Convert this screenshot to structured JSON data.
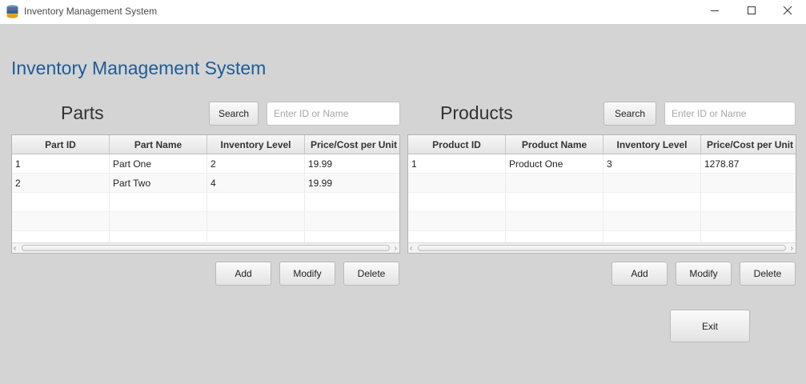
{
  "window": {
    "title": "Inventory Management System"
  },
  "app_heading": "Inventory Management System",
  "parts": {
    "title": "Parts",
    "search_label": "Search",
    "search_placeholder": "Enter ID or Name",
    "columns": [
      "Part ID",
      "Part Name",
      "Inventory Level",
      "Price/Cost per Unit"
    ],
    "rows": [
      [
        "1",
        "Part One",
        "2",
        "19.99"
      ],
      [
        "2",
        "Part Two",
        "4",
        "19.99"
      ]
    ],
    "add_label": "Add",
    "modify_label": "Modify",
    "delete_label": "Delete"
  },
  "products": {
    "title": "Products",
    "search_label": "Search",
    "search_placeholder": "Enter ID or Name",
    "columns": [
      "Product ID",
      "Product Name",
      "Inventory Level",
      "Price/Cost per Unit"
    ],
    "rows": [
      [
        "1",
        "Product One",
        "3",
        "1278.87"
      ]
    ],
    "add_label": "Add",
    "modify_label": "Modify",
    "delete_label": "Delete"
  },
  "exit_label": "Exit",
  "colors": {
    "heading": "#1e5c96",
    "background": "#d4d4d4"
  },
  "icons": {
    "app": "database-icon",
    "minimize": "minimize-icon",
    "maximize": "maximize-icon",
    "close": "close-icon"
  }
}
